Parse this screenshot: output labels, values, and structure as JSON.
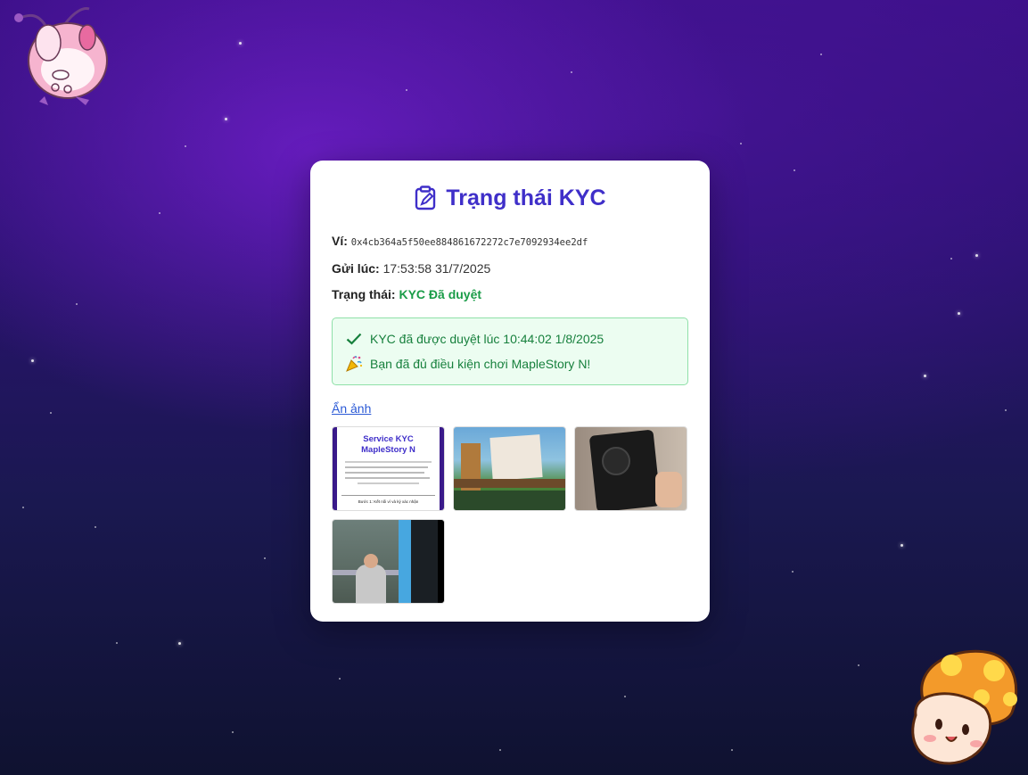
{
  "card": {
    "title": "Trạng thái KYC",
    "wallet_label": "Ví:",
    "wallet_value": "0x4cb364a5f50ee884861672272c7e7092934ee2df",
    "sent_label": "Gửi lúc:",
    "sent_value": "17:53:58 31/7/2025",
    "status_label": "Trạng thái:",
    "status_value": "KYC Đã duyệt",
    "status_color": "#1a9c48"
  },
  "notice": {
    "approved_text": "KYC đã được duyệt lúc 10:44:02 1/8/2025",
    "eligible_text": "Bạn đã đủ điều kiện chơi MapleStory N!",
    "approved_icon": "check-icon",
    "eligible_icon": "party-popper-icon"
  },
  "images": {
    "toggle_label": "Ẩn ảnh",
    "thumb1_title": "Service KYC MapleStory N",
    "thumb1_step": "Bước 1: Kết nối ví và ký xác nhận"
  },
  "colors": {
    "title": "#3f2fc9",
    "success": "#1a9c48",
    "link": "#2b5ad6"
  }
}
